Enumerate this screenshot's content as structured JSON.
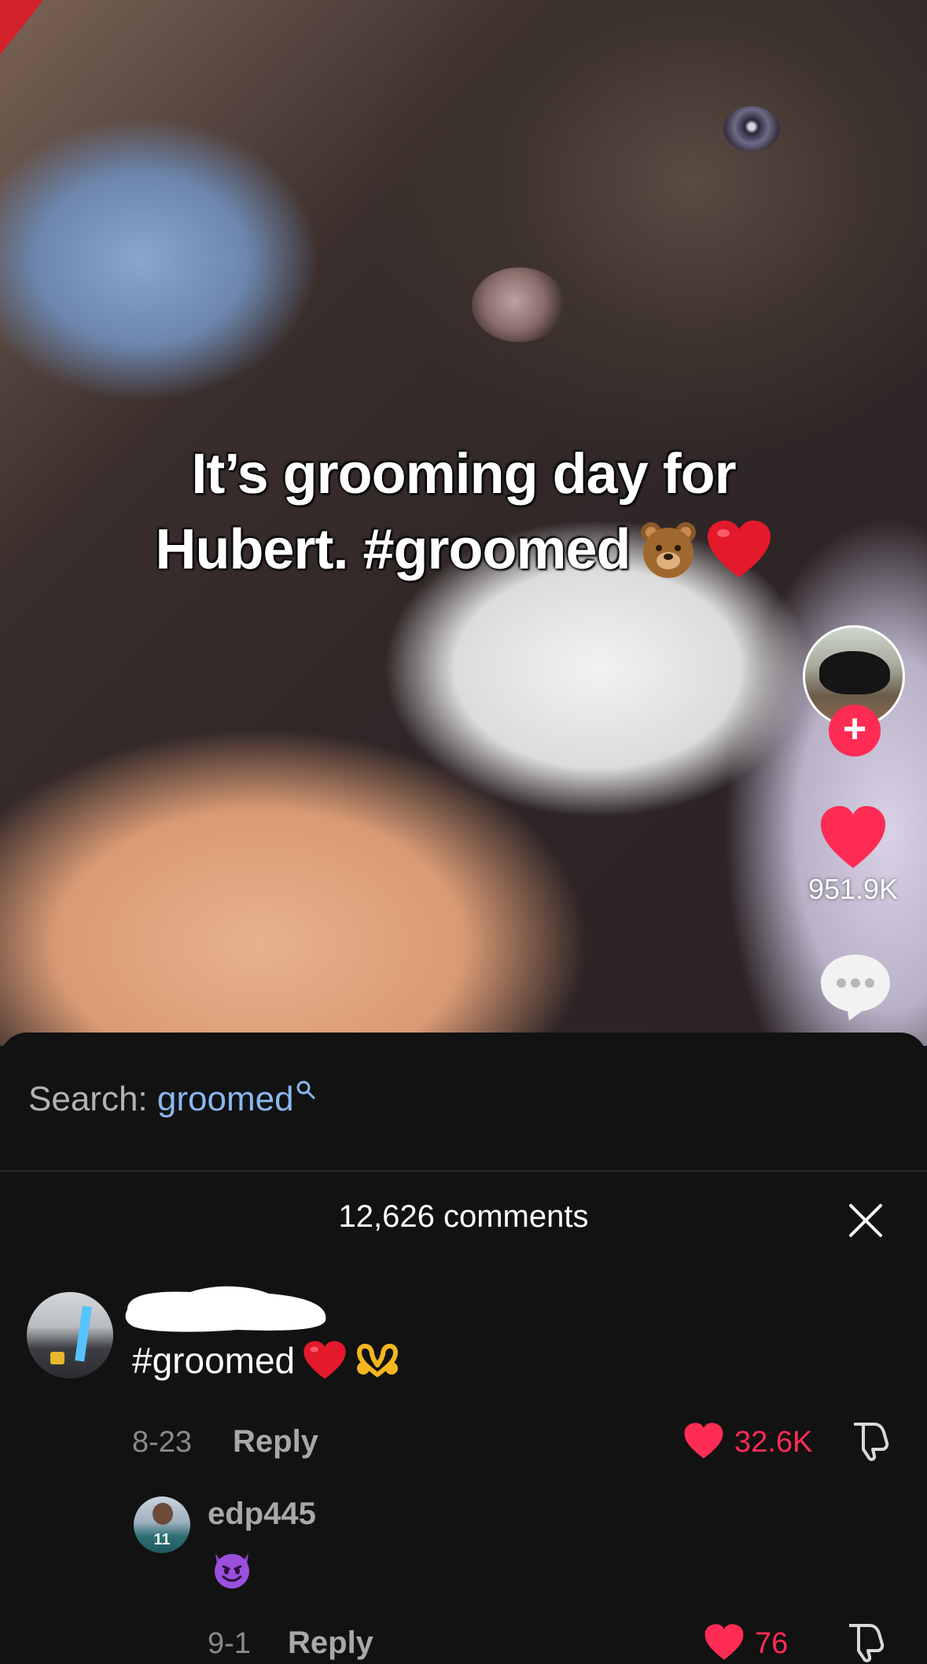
{
  "video": {
    "caption_line1": "It’s grooming day for",
    "caption_line2": "Hubert. #groomed",
    "like_count": "951.9K"
  },
  "sheet": {
    "search_prefix": "Search:",
    "search_keyword": "groomed",
    "comments_count": "12,626 comments"
  },
  "comments": [
    {
      "text": "#groomed",
      "date": "8-23",
      "reply_label": "Reply",
      "like_count": "32.6K"
    },
    {
      "username": "edp445",
      "avatar_jersey": "11",
      "date": "9-1",
      "reply_label": "Reply",
      "like_count": "76"
    }
  ],
  "colors": {
    "accent_red": "#fe2c55",
    "search_keyword_blue": "#8ab8f0",
    "sheet_bg": "#121212"
  },
  "icons": [
    "follow-plus-icon",
    "heart-icon",
    "comment-bubble-icon",
    "search-icon",
    "close-icon",
    "dislike-icon",
    "bear-emoji",
    "red-heart-emoji",
    "heart-hands-emoji",
    "smiling-devil-emoji"
  ]
}
